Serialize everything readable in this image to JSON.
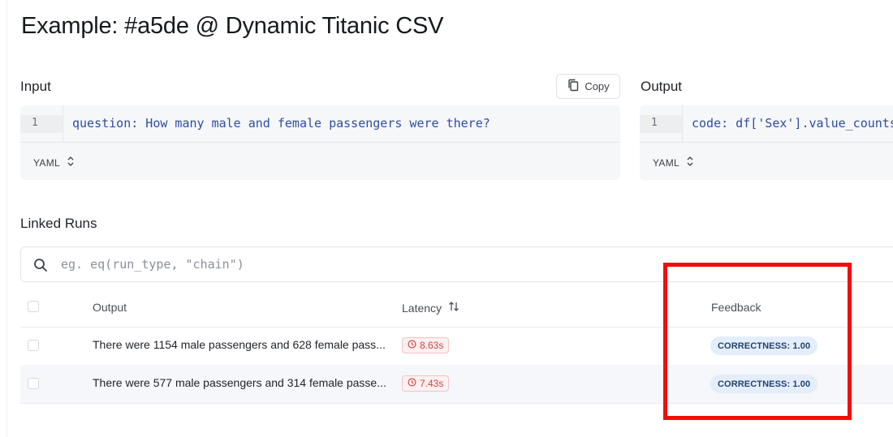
{
  "page": {
    "title": "Example: #a5de @ Dynamic Titanic CSV"
  },
  "input": {
    "label": "Input",
    "copy_label": "Copy",
    "line_number": "1",
    "code": "question: How many male and female passengers were there?",
    "format": "YAML"
  },
  "output": {
    "label": "Output",
    "line_number": "1",
    "code": "code: df['Sex'].value_counts()",
    "format": "YAML"
  },
  "linked_runs": {
    "label": "Linked Runs",
    "search_placeholder": "eg. eq(run_type, \"chain\")",
    "columns": {
      "output": "Output",
      "latency": "Latency",
      "feedback": "Feedback"
    },
    "rows": [
      {
        "output": "There were 1154 male passengers and 628 female pass...",
        "latency": "8.63s",
        "feedback": "CORRECTNESS: 1.00"
      },
      {
        "output": "There were 577 male passengers and 314 female passe...",
        "latency": "7.43s",
        "feedback": "CORRECTNESS: 1.00"
      }
    ]
  },
  "colors": {
    "highlight": "#f20d0d",
    "latency_badge": "#d14343",
    "feedback_badge_bg": "#e4eefb",
    "code_text": "#2f4da3"
  },
  "icons": [
    "copy-icon",
    "sort-toggle-icon",
    "search-icon",
    "sort-icon",
    "clock-icon"
  ]
}
